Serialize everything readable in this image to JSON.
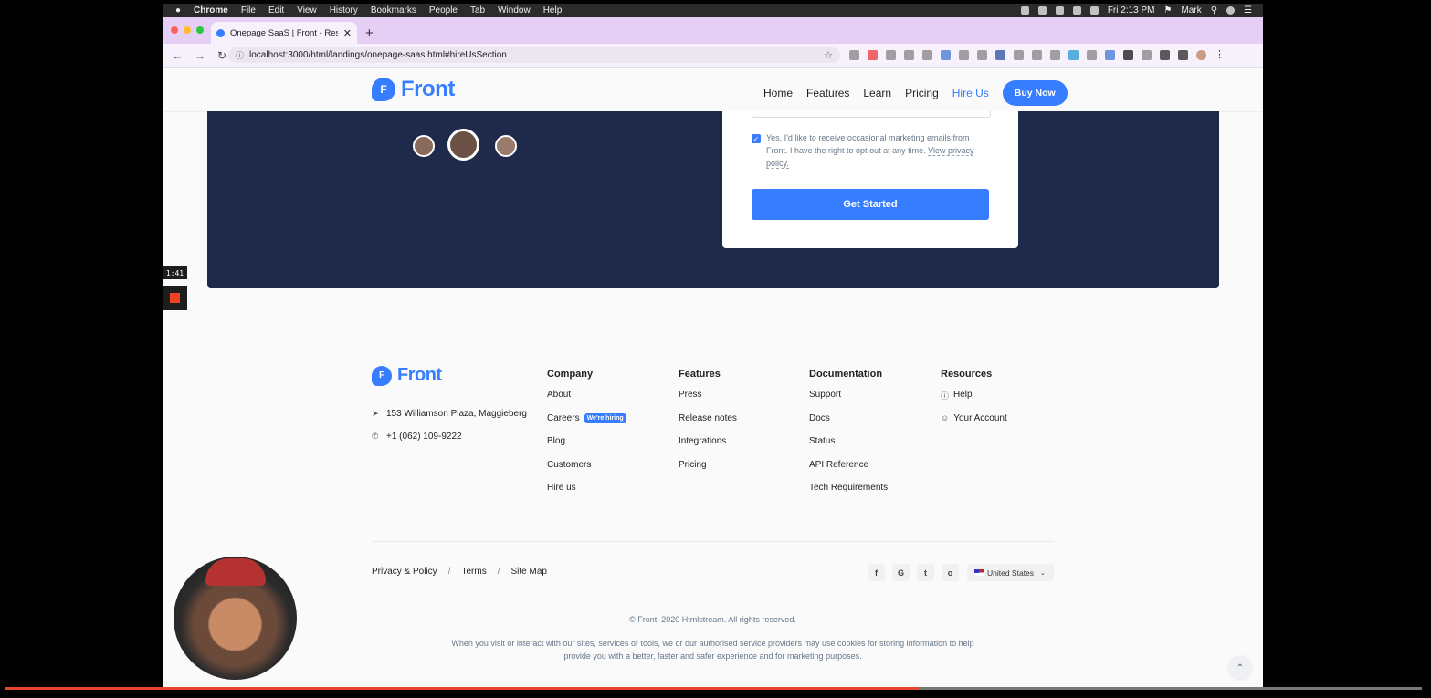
{
  "menubar": {
    "apple": "",
    "app": "Chrome",
    "items": [
      "File",
      "Edit",
      "View",
      "History",
      "Bookmarks",
      "People",
      "Tab",
      "Window",
      "Help"
    ],
    "clock": "Fri 2:13 PM",
    "user": "Mark"
  },
  "browser": {
    "tab_title": "Onepage SaaS | Front - Respo",
    "url": "localhost:3000/html/landings/onepage-saas.html#hireUsSection"
  },
  "site": {
    "logo_mark": "F",
    "logo_text": "Front",
    "nav": [
      "Home",
      "Features",
      "Learn",
      "Pricing",
      "Hire Us"
    ],
    "buy_now": "Buy Now"
  },
  "form": {
    "consent_text": "Yes, I'd like to receive occasional marketing emails from Front. I have the right to opt out at any time.",
    "consent_link": "View privacy policy.",
    "submit": "Get Started"
  },
  "recorder": {
    "time": "1:41",
    "progress_fraction": 0.645
  },
  "footer": {
    "address": "153 Williamson Plaza, Maggieberg",
    "phone": "+1 (062) 109-9222",
    "columns": {
      "company": {
        "title": "Company",
        "items": [
          "About",
          "Careers",
          "Blog",
          "Customers",
          "Hire us"
        ],
        "badge": "We're hiring"
      },
      "features": {
        "title": "Features",
        "items": [
          "Press",
          "Release notes",
          "Integrations",
          "Pricing"
        ]
      },
      "documentation": {
        "title": "Documentation",
        "items": [
          "Support",
          "Docs",
          "Status",
          "API Reference",
          "Tech Requirements"
        ]
      },
      "resources": {
        "title": "Resources",
        "items": [
          "Help",
          "Your Account"
        ]
      }
    },
    "legal": [
      "Privacy & Policy",
      "Terms",
      "Site Map"
    ],
    "legal_sep": "/",
    "socials": [
      "f",
      "G",
      "t",
      "o"
    ],
    "language": "United States",
    "copyright": "© Front. 2020 Htmlstream. All rights reserved.",
    "cookie": "When you visit or interact with our sites, services or tools, we or our authorised service providers may use cookies for storing information to help provide you with a better, faster and safer experience and for marketing purposes."
  },
  "colors": {
    "primary": "#377dff",
    "hero_bg": "#1f2a4a",
    "tab_strip": "#e5cff5"
  }
}
